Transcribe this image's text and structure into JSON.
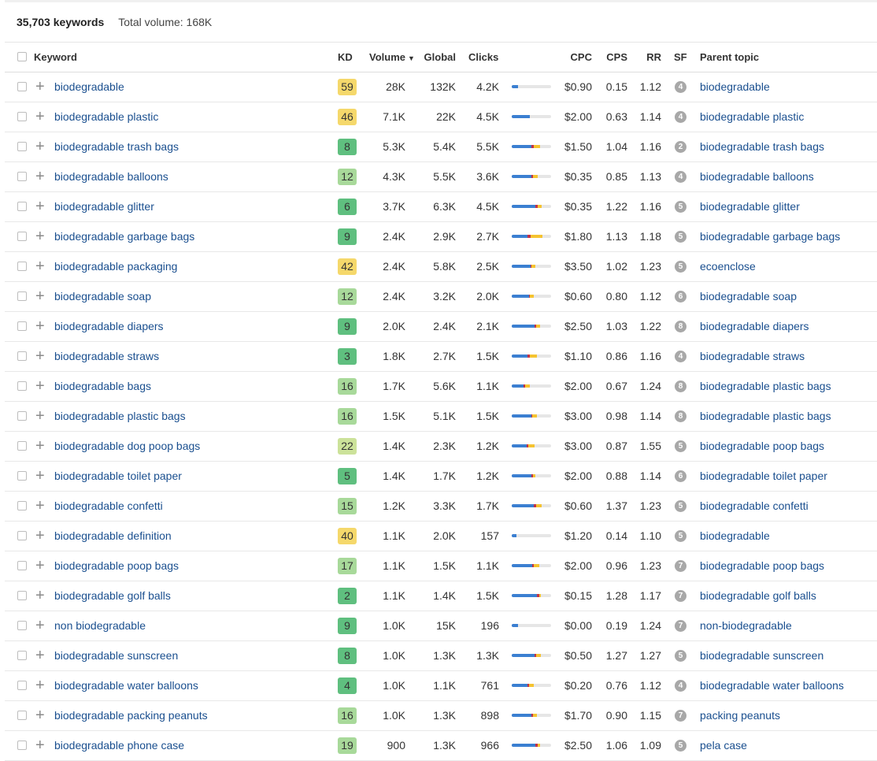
{
  "summary": {
    "keyword_count": "35,703 keywords",
    "total_volume": "Total volume: 168K"
  },
  "columns": {
    "keyword": "Keyword",
    "kd": "KD",
    "volume": "Volume",
    "global": "Global",
    "clicks": "Clicks",
    "cpc": "CPC",
    "cps": "CPS",
    "rr": "RR",
    "sf": "SF",
    "parent_topic": "Parent topic"
  },
  "sort": {
    "column": "Volume",
    "direction_icon": "▼"
  },
  "kd_colors": {
    "easy": "#5fbf7f",
    "medium": "#a8d99a",
    "mid": "#cce29a",
    "hard": "#f5d86b"
  },
  "click_bar_colors": {
    "organic": "#3b7fd1",
    "paid": "#c0334a",
    "other": "#f5c330"
  },
  "rows": [
    {
      "keyword": "biodegradable",
      "kd": "59",
      "volume": "28K",
      "global": "132K",
      "clicks": "4.2K",
      "clicks_mix": [
        0.15,
        0,
        0
      ],
      "cpc": "$0.90",
      "cps": "0.15",
      "rr": "1.12",
      "sf": "4",
      "parent": "biodegradable"
    },
    {
      "keyword": "biodegradable plastic",
      "kd": "46",
      "volume": "7.1K",
      "global": "22K",
      "clicks": "4.5K",
      "clicks_mix": [
        0.45,
        0,
        0
      ],
      "cpc": "$2.00",
      "cps": "0.63",
      "rr": "1.14",
      "sf": "4",
      "parent": "biodegradable plastic"
    },
    {
      "keyword": "biodegradable trash bags",
      "kd": "8",
      "volume": "5.3K",
      "global": "5.4K",
      "clicks": "5.5K",
      "clicks_mix": [
        0.5,
        0.05,
        0.16
      ],
      "cpc": "$1.50",
      "cps": "1.04",
      "rr": "1.16",
      "sf": "2",
      "parent": "biodegradable trash bags"
    },
    {
      "keyword": "biodegradable balloons",
      "kd": "12",
      "volume": "4.3K",
      "global": "5.5K",
      "clicks": "3.6K",
      "clicks_mix": [
        0.5,
        0.03,
        0.12
      ],
      "cpc": "$0.35",
      "cps": "0.85",
      "rr": "1.13",
      "sf": "4",
      "parent": "biodegradable balloons"
    },
    {
      "keyword": "biodegradable glitter",
      "kd": "6",
      "volume": "3.7K",
      "global": "6.3K",
      "clicks": "4.5K",
      "clicks_mix": [
        0.6,
        0.05,
        0.1
      ],
      "cpc": "$0.35",
      "cps": "1.22",
      "rr": "1.16",
      "sf": "5",
      "parent": "biodegradable glitter"
    },
    {
      "keyword": "biodegradable garbage bags",
      "kd": "9",
      "volume": "2.4K",
      "global": "2.9K",
      "clicks": "2.7K",
      "clicks_mix": [
        0.4,
        0.08,
        0.3
      ],
      "cpc": "$1.80",
      "cps": "1.13",
      "rr": "1.18",
      "sf": "5",
      "parent": "biodegradable garbage bags"
    },
    {
      "keyword": "biodegradable packaging",
      "kd": "42",
      "volume": "2.4K",
      "global": "5.8K",
      "clicks": "2.5K",
      "clicks_mix": [
        0.48,
        0.02,
        0.1
      ],
      "cpc": "$3.50",
      "cps": "1.02",
      "rr": "1.23",
      "sf": "5",
      "parent": "ecoenclose"
    },
    {
      "keyword": "biodegradable soap",
      "kd": "12",
      "volume": "2.4K",
      "global": "3.2K",
      "clicks": "2.0K",
      "clicks_mix": [
        0.44,
        0.02,
        0.1
      ],
      "cpc": "$0.60",
      "cps": "0.80",
      "rr": "1.12",
      "sf": "6",
      "parent": "biodegradable soap"
    },
    {
      "keyword": "biodegradable diapers",
      "kd": "9",
      "volume": "2.0K",
      "global": "2.4K",
      "clicks": "2.1K",
      "clicks_mix": [
        0.58,
        0.04,
        0.1
      ],
      "cpc": "$2.50",
      "cps": "1.03",
      "rr": "1.22",
      "sf": "8",
      "parent": "biodegradable diapers"
    },
    {
      "keyword": "biodegradable straws",
      "kd": "3",
      "volume": "1.8K",
      "global": "2.7K",
      "clicks": "1.5K",
      "clicks_mix": [
        0.4,
        0.05,
        0.18
      ],
      "cpc": "$1.10",
      "cps": "0.86",
      "rr": "1.16",
      "sf": "4",
      "parent": "biodegradable straws"
    },
    {
      "keyword": "biodegradable bags",
      "kd": "16",
      "volume": "1.7K",
      "global": "5.6K",
      "clicks": "1.1K",
      "clicks_mix": [
        0.3,
        0.04,
        0.12
      ],
      "cpc": "$2.00",
      "cps": "0.67",
      "rr": "1.24",
      "sf": "8",
      "parent": "biodegradable plastic bags"
    },
    {
      "keyword": "biodegradable plastic bags",
      "kd": "16",
      "volume": "1.5K",
      "global": "5.1K",
      "clicks": "1.5K",
      "clicks_mix": [
        0.5,
        0.02,
        0.12
      ],
      "cpc": "$3.00",
      "cps": "0.98",
      "rr": "1.14",
      "sf": "8",
      "parent": "biodegradable plastic bags"
    },
    {
      "keyword": "biodegradable dog poop bags",
      "kd": "22",
      "volume": "1.4K",
      "global": "2.3K",
      "clicks": "1.2K",
      "clicks_mix": [
        0.38,
        0.04,
        0.16
      ],
      "cpc": "$3.00",
      "cps": "0.87",
      "rr": "1.55",
      "sf": "5",
      "parent": "biodegradable poop bags"
    },
    {
      "keyword": "biodegradable toilet paper",
      "kd": "5",
      "volume": "1.4K",
      "global": "1.7K",
      "clicks": "1.2K",
      "clicks_mix": [
        0.5,
        0.04,
        0.06
      ],
      "cpc": "$2.00",
      "cps": "0.88",
      "rr": "1.14",
      "sf": "6",
      "parent": "biodegradable toilet paper"
    },
    {
      "keyword": "biodegradable confetti",
      "kd": "15",
      "volume": "1.2K",
      "global": "3.3K",
      "clicks": "1.7K",
      "clicks_mix": [
        0.55,
        0.06,
        0.14
      ],
      "cpc": "$0.60",
      "cps": "1.37",
      "rr": "1.23",
      "sf": "5",
      "parent": "biodegradable confetti"
    },
    {
      "keyword": "biodegradable definition",
      "kd": "40",
      "volume": "1.1K",
      "global": "2.0K",
      "clicks": "157",
      "clicks_mix": [
        0.12,
        0,
        0
      ],
      "cpc": "$1.20",
      "cps": "0.14",
      "rr": "1.10",
      "sf": "5",
      "parent": "biodegradable"
    },
    {
      "keyword": "biodegradable poop bags",
      "kd": "17",
      "volume": "1.1K",
      "global": "1.5K",
      "clicks": "1.1K",
      "clicks_mix": [
        0.52,
        0.04,
        0.14
      ],
      "cpc": "$2.00",
      "cps": "0.96",
      "rr": "1.23",
      "sf": "7",
      "parent": "biodegradable poop bags"
    },
    {
      "keyword": "biodegradable golf balls",
      "kd": "2",
      "volume": "1.1K",
      "global": "1.4K",
      "clicks": "1.5K",
      "clicks_mix": [
        0.64,
        0.06,
        0.04
      ],
      "cpc": "$0.15",
      "cps": "1.28",
      "rr": "1.17",
      "sf": "7",
      "parent": "biodegradable golf balls"
    },
    {
      "keyword": "non biodegradable",
      "kd": "9",
      "volume": "1.0K",
      "global": "15K",
      "clicks": "196",
      "clicks_mix": [
        0.15,
        0,
        0
      ],
      "cpc": "$0.00",
      "cps": "0.19",
      "rr": "1.24",
      "sf": "7",
      "parent": "non-biodegradable"
    },
    {
      "keyword": "biodegradable sunscreen",
      "kd": "8",
      "volume": "1.0K",
      "global": "1.3K",
      "clicks": "1.3K",
      "clicks_mix": [
        0.58,
        0.04,
        0.12
      ],
      "cpc": "$0.50",
      "cps": "1.27",
      "rr": "1.27",
      "sf": "5",
      "parent": "biodegradable sunscreen"
    },
    {
      "keyword": "biodegradable water balloons",
      "kd": "4",
      "volume": "1.0K",
      "global": "1.1K",
      "clicks": "761",
      "clicks_mix": [
        0.4,
        0.04,
        0.12
      ],
      "cpc": "$0.20",
      "cps": "0.76",
      "rr": "1.12",
      "sf": "4",
      "parent": "biodegradable water balloons"
    },
    {
      "keyword": "biodegradable packing peanuts",
      "kd": "16",
      "volume": "1.0K",
      "global": "1.3K",
      "clicks": "898",
      "clicks_mix": [
        0.5,
        0.04,
        0.1
      ],
      "cpc": "$1.70",
      "cps": "0.90",
      "rr": "1.15",
      "sf": "7",
      "parent": "packing peanuts"
    },
    {
      "keyword": "biodegradable phone case",
      "kd": "19",
      "volume": "900",
      "global": "1.3K",
      "clicks": "966",
      "clicks_mix": [
        0.6,
        0.06,
        0.06
      ],
      "cpc": "$2.50",
      "cps": "1.06",
      "rr": "1.09",
      "sf": "5",
      "parent": "pela case"
    }
  ]
}
